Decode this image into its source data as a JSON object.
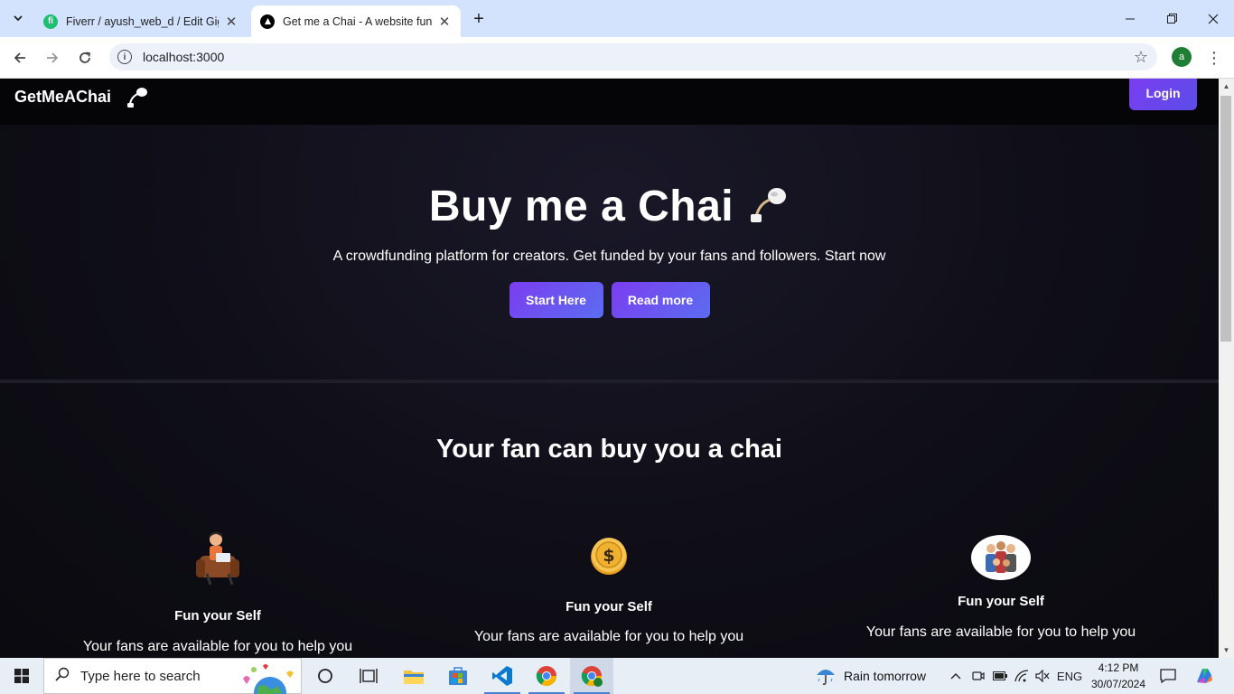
{
  "browser": {
    "tabs": [
      {
        "title": "Fiverr / ayush_web_d / Edit Gig",
        "active": false
      },
      {
        "title": "Get me a Chai - A website fun y",
        "active": true
      }
    ],
    "url": "localhost:3000"
  },
  "page": {
    "brand": "GetMeAChai",
    "login_label": "Login",
    "hero": {
      "title": "Buy me a Chai",
      "subtitle": "A crowdfunding platform for creators. Get funded by your fans and followers. Start now",
      "start_label": "Start Here",
      "read_label": "Read more"
    },
    "section_title": "Your fan can buy you a chai",
    "features": [
      {
        "icon": "man-working-icon",
        "title": "Fun your Self",
        "desc": "Your fans are available for you to help you"
      },
      {
        "icon": "coin-icon",
        "title": "Fun your Self",
        "desc": "Your fans are available for you to help you"
      },
      {
        "icon": "group-icon",
        "title": "Fun your Self",
        "desc": "Your fans are available for you to help you"
      }
    ]
  },
  "taskbar": {
    "search_placeholder": "Type here to search",
    "weather": "Rain tomorrow",
    "language": "ENG",
    "time": "4:12 PM",
    "date": "30/07/2024"
  },
  "colors": {
    "accent_start": "#7b3df0",
    "accent_end": "#5b6df0",
    "page_bg": "#0f0e17",
    "tabstrip_bg": "#d3e3fd"
  }
}
